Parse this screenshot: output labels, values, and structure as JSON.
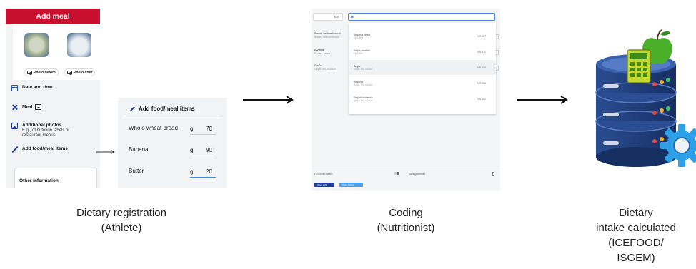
{
  "phone": {
    "header_title": "Add meal",
    "photo_before_label": "Photo before",
    "photo_after_label": "Photo after",
    "date_time_label": "Date and time",
    "meal_label": "Meal",
    "additional_photos_label": "Additional photos",
    "additional_photos_hint_1": "E.g., of nutrition labels or",
    "additional_photos_hint_2": "restaurant menus",
    "add_food_label": "Add food/meal items",
    "other_info_label": "Other information"
  },
  "food_card": {
    "title": "Add food/meal items",
    "items": [
      {
        "name": "Whole wheat bread",
        "unit": "g",
        "qty": "70"
      },
      {
        "name": "Banana",
        "unit": "g",
        "qty": "90"
      },
      {
        "name": "Butter",
        "unit": "g",
        "qty": "20"
      }
    ]
  },
  "coding": {
    "left_box": "Edit",
    "search_value": "sm",
    "side_items": [
      {
        "name": "Brauð, heilhveitibrauð",
        "sub": "Brauð, heilhveitibrauð"
      },
      {
        "name": "Bananar",
        "sub": "Banani, ferskt"
      },
      {
        "name": "Smjör",
        "sub": "Smjör, fitu, ósöltuð"
      }
    ],
    "results": [
      {
        "name": "Smjörva, léttur",
        "sub": "Fjölt léttir",
        "code": "NR 307"
      },
      {
        "name": "Smjör, ósaltað",
        "sub": "Fjölt léttir",
        "code": "NR 312"
      },
      {
        "name": "Smjör",
        "sub": "Smjör, fitu, ósöltuð",
        "code": "NR 305"
      },
      {
        "name": "Smjörva",
        "sub": "Smjör, fitu, ósöltuð",
        "code": "NR 308"
      },
      {
        "name": "Smjörlíkisblanda",
        "sub": "Smjör, fitu, ósöltuð",
        "code": "NR 302"
      }
    ],
    "footer_left": "Fullunnin máltíð",
    "footer_right": "Athugasemdir",
    "button_1": "Vista · Eftir",
    "button_2": "Vista · Næsta"
  },
  "captions": {
    "registration_line1": "Dietary registration",
    "registration_line2": "(Athlete)",
    "coding_line1": "Coding",
    "coding_line2": "(Nutritionist)",
    "intake_line1": "Dietary",
    "intake_line2": "intake calculated",
    "intake_line3": "(ICEFOOD/",
    "intake_line4": "ISGEM)"
  },
  "colors": {
    "header_red": "#c8102e",
    "accent_blue": "#1f3a8a",
    "database_blue": "#1f3d7a",
    "apple_green": "#4caf2a",
    "gear_blue": "#2ea0e8"
  }
}
